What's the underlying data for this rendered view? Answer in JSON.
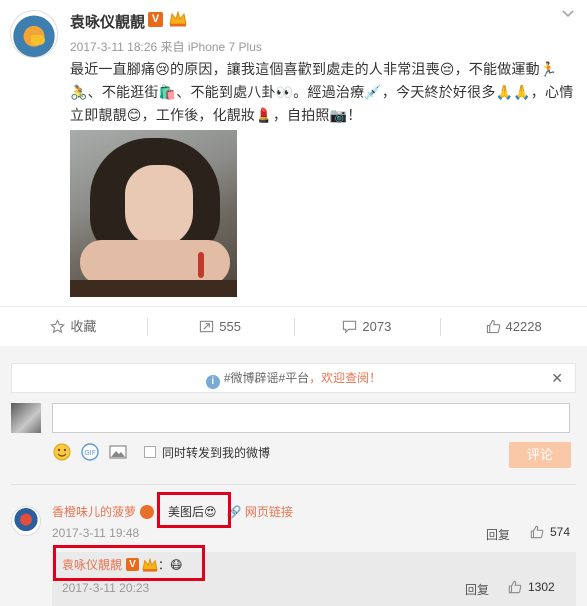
{
  "post": {
    "username": "袁咏仪靚靚",
    "verified_badge": "V",
    "meta": "2017-3-11 18:26 来自 iPhone 7 Plus",
    "content": "最近一直腳痛😢的原因，讓我這個喜歡到處走的人非常沮喪😔，不能做運動🏃🚴、不能逛街🛍️、不能到處八卦👀。經過治療💉，今天終於好很多🙏🙏，心情立即靚靚😊，工作後，化靚妝💄，自拍照📷！"
  },
  "actions": {
    "favorite_label": "收藏",
    "repost_count": "555",
    "comment_count": "2073",
    "like_count": "42228"
  },
  "comment_box": {
    "notice_tag": "#微博辟谣#平台",
    "notice_suffix": "，欢迎查阅！",
    "also_repost_label": "同时转发到我的微博",
    "submit_label": "评论"
  },
  "comments": [
    {
      "author": "香橙味儿的菠萝",
      "text": "：美图后😍",
      "link_label": "网页链接",
      "time": "2017-3-11 19:48",
      "reply_label": "回复",
      "likes": "574"
    }
  ],
  "subreply": {
    "author": "袁咏仪靚靚",
    "verified_badge": "V",
    "text": "：😷",
    "time": "2017-3-11 20:23",
    "reply_label": "回复",
    "likes": "1302"
  },
  "colors": {
    "accent_orange": "#eb7350",
    "highlight_red": "#e0001b",
    "verified_orange": "#e86a1a"
  }
}
